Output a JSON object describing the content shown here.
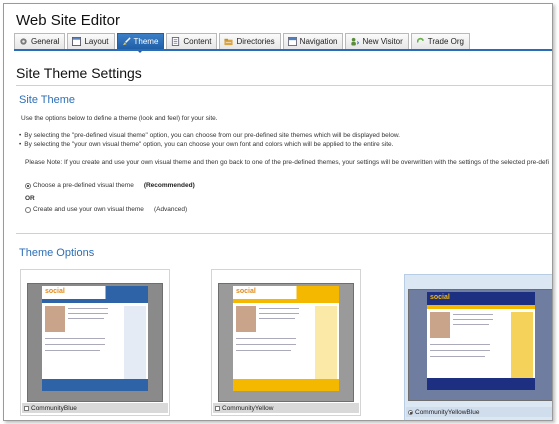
{
  "window": {
    "title": "Web Site Editor"
  },
  "tabs": [
    {
      "label": "General",
      "icon": "gear-icon"
    },
    {
      "label": "Layout",
      "icon": "layout-icon"
    },
    {
      "label": "Theme",
      "icon": "brush-icon",
      "active": true
    },
    {
      "label": "Content",
      "icon": "document-icon"
    },
    {
      "label": "Directories",
      "icon": "folder-icon"
    },
    {
      "label": "Navigation",
      "icon": "navigation-icon"
    },
    {
      "label": "New Visitor",
      "icon": "visitor-icon"
    },
    {
      "label": "Trade Org",
      "icon": "recycle-icon"
    }
  ],
  "page": {
    "title": "Site Theme Settings"
  },
  "site_theme": {
    "heading": "Site Theme",
    "intro": "Use the options below to define a theme (look and feel) for your site.",
    "bullets": [
      "By selecting the \"pre-defined visual theme\" option, you can choose from our pre-defined site themes which will be displayed below.",
      "By selecting the \"your own visual theme\" option, you can choose your own font and colors which will be applied to the entire site."
    ],
    "note": "Please Note: If you create and use your own visual theme and then go back to one of the pre-defined themes, your settings will be overwritten with the settings of the selected pre-defi",
    "option_predefined": "Choose a pre-defined visual theme",
    "option_predefined_tag": "(Recommended)",
    "or_label": "OR",
    "option_own": "Create and use your own visual theme",
    "option_own_tag": "(Advanced)",
    "selected_option": "predefined"
  },
  "theme_options": {
    "heading": "Theme Options",
    "themes": [
      {
        "name": "CommunityBlue",
        "logo": "social",
        "selected": false
      },
      {
        "name": "CommunityYellow",
        "logo": "social",
        "selected": false
      },
      {
        "name": "CommunityYellowBlue",
        "logo": "social",
        "selected": true
      }
    ]
  },
  "colors": {
    "accent": "#2c6fb7",
    "active_tab": "#1e5fa8",
    "selected_card": "#dbe7f3",
    "theme_blue": "#2f63a8",
    "theme_yellow": "#f5b800",
    "theme_navy": "#1c2f80"
  }
}
